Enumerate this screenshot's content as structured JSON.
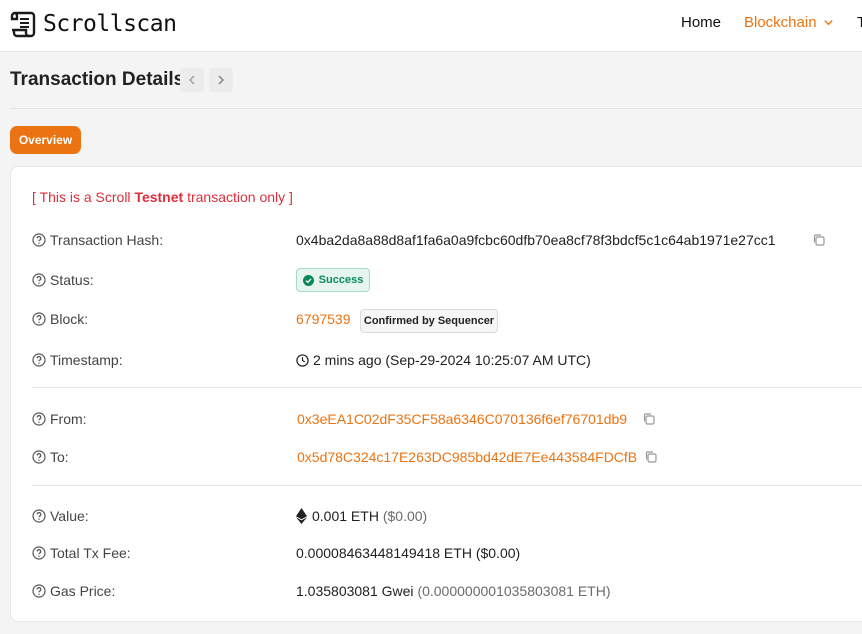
{
  "header": {
    "logo_text": "Scrollscan",
    "nav": {
      "home": "Home",
      "blockchain": "Blockchain",
      "cut_item": "T"
    }
  },
  "page": {
    "title": "Transaction Details",
    "tab_overview": "Overview"
  },
  "notice": {
    "prefix": "[ This is a Scroll ",
    "strong": "Testnet",
    "suffix": " transaction only ]"
  },
  "fields": {
    "tx_hash": {
      "label": "Transaction Hash:",
      "value": "0x4ba2da8a88d8af1fa6a0a9fcbc60dfb70ea8cf78f3bdcf5c1c64ab1971e27cc1"
    },
    "status": {
      "label": "Status:",
      "value": "Success"
    },
    "block": {
      "label": "Block:",
      "value": "6797539",
      "badge": "Confirmed by Sequencer"
    },
    "timestamp": {
      "label": "Timestamp:",
      "value": "2 mins ago (Sep-29-2024 10:25:07 AM UTC)"
    },
    "from": {
      "label": "From:",
      "value": "0x3eEA1C02dF35CF58a6346C070136f6ef76701db9"
    },
    "to": {
      "label": "To:",
      "value": "0x5d78C324c17E263DC985bd42dE7Ee443584FDCfB"
    },
    "value": {
      "label": "Value:",
      "amount": "0.001 ETH",
      "usd": "($0.00)"
    },
    "fee": {
      "label": "Total Tx Fee:",
      "value": "0.00008463448149418 ETH ($0.00)"
    },
    "gas": {
      "label": "Gas Price:",
      "gwei": "1.035803081 Gwei",
      "eth": "(0.000000001035803081 ETH)"
    }
  },
  "colors": {
    "accent": "#ec7312",
    "success": "#0b8a5a",
    "notice": "#dc2f3b"
  },
  "icons": [
    "scroll-logo-icon",
    "chevron-down-icon",
    "chevron-left-icon",
    "chevron-right-icon",
    "question-circle-icon",
    "check-circle-icon",
    "clock-icon",
    "eth-icon",
    "copy-icon"
  ]
}
